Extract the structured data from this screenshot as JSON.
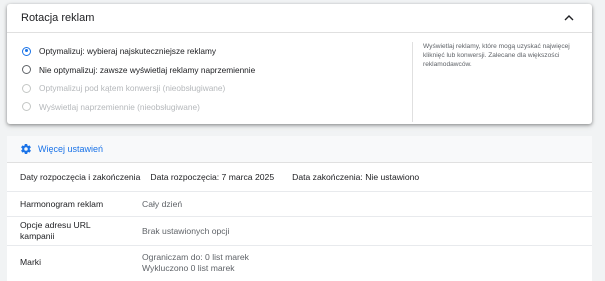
{
  "ad_rotation": {
    "title": "Rotacja reklam",
    "options": [
      {
        "label": "Optymalizuj: wybieraj najskuteczniejsze reklamy",
        "state": "checked"
      },
      {
        "label": "Nie optymalizuj: zawsze wyświetlaj reklamy naprzemiennie",
        "state": "unchecked"
      },
      {
        "label": "Optymalizuj pod kątem konwersji (nieobsługiwane)",
        "state": "disabled"
      },
      {
        "label": "Wyświetlaj naprzemiennie (nieobsługiwane)",
        "state": "disabled"
      }
    ],
    "help_text": "Wyświetlaj reklamy, które mogą uzyskać najwięcej kliknięć lub konwersji. Zalecane dla większości reklamodawców."
  },
  "more_settings": {
    "label": "Więcej ustawień"
  },
  "dates": {
    "label": "Daty rozpoczęcia i zakończenia",
    "start": "Data rozpoczęcia: 7 marca 2025",
    "end": "Data zakończenia: Nie ustawiono"
  },
  "schedule": {
    "label": "Harmonogram reklam",
    "value": "Cały dzień"
  },
  "url_options": {
    "label_line1": "Opcje adresu URL",
    "label_line2": "kampanii",
    "value": "Brak ustawionych opcji"
  },
  "brands": {
    "label": "Marki",
    "value_line1": "Ograniczam do: 0 list marek",
    "value_line2": "Wykluczono 0 list marek"
  },
  "colors": {
    "accent": "#1a73e8",
    "text": "#202124",
    "secondary": "#5f6368"
  }
}
